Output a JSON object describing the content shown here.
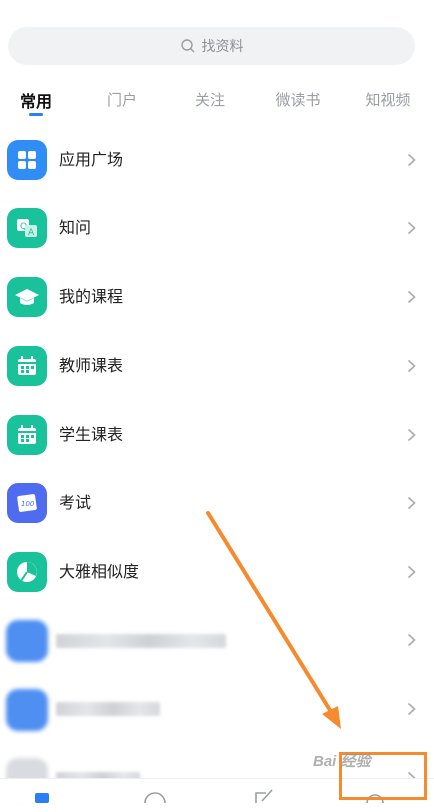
{
  "search": {
    "placeholder": "找资料",
    "icon": "search-icon"
  },
  "tabs": [
    {
      "label": "常用",
      "active": true
    },
    {
      "label": "门户",
      "active": false
    },
    {
      "label": "关注",
      "active": false
    },
    {
      "label": "微读书",
      "active": false
    },
    {
      "label": "知视频",
      "active": false
    }
  ],
  "list": [
    {
      "label": "应用广场",
      "icon": "app-grid-icon",
      "color": "#2f8df5"
    },
    {
      "label": "知问",
      "icon": "qa-icon",
      "color": "#19c29a"
    },
    {
      "label": "我的课程",
      "icon": "graduation-cap-icon",
      "color": "#19c29a"
    },
    {
      "label": "教师课表",
      "icon": "calendar-icon",
      "color": "#19c29a"
    },
    {
      "label": "学生课表",
      "icon": "calendar-icon",
      "color": "#19c29a"
    },
    {
      "label": "考试",
      "icon": "exam-score-icon",
      "color": "#4f6cf0"
    },
    {
      "label": "大雅相似度",
      "icon": "similarity-icon",
      "color": "#19c29a"
    }
  ],
  "annotation": {
    "arrow_color": "#f58a2f"
  },
  "watermark": {
    "text": "Bai 经验"
  }
}
